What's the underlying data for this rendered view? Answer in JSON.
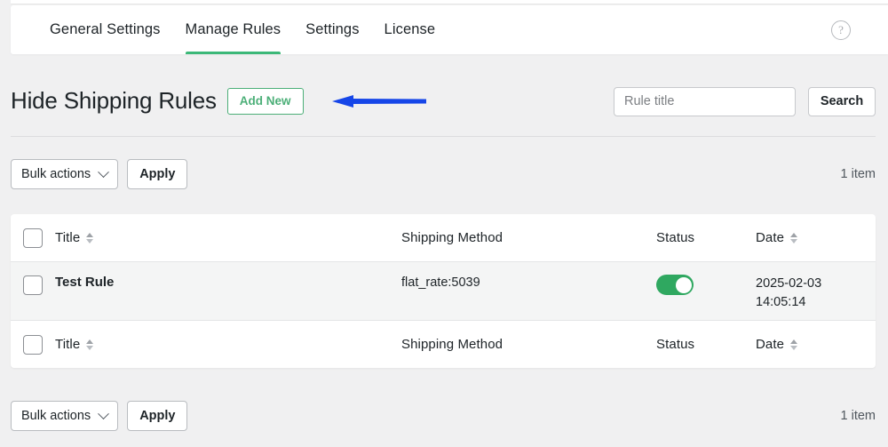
{
  "tabbar": {
    "tabs": [
      {
        "label": "General Settings",
        "active": false
      },
      {
        "label": "Manage Rules",
        "active": true
      },
      {
        "label": "Settings",
        "active": false
      },
      {
        "label": "License",
        "active": false
      }
    ],
    "help_icon_glyph": "?"
  },
  "header": {
    "title": "Hide Shipping Rules",
    "add_new_label": "Add New",
    "search_placeholder": "Rule title",
    "search_value": "",
    "search_button_label": "Search"
  },
  "annotation": {
    "type": "arrow-left",
    "color": "#1646e8"
  },
  "bulk_top": {
    "select_label": "Bulk actions",
    "apply_label": "Apply",
    "item_count": "1 item"
  },
  "bulk_bottom": {
    "select_label": "Bulk actions",
    "apply_label": "Apply",
    "item_count": "1 item"
  },
  "table": {
    "columns": {
      "title": "Title",
      "method": "Shipping Method",
      "status": "Status",
      "date": "Date"
    },
    "rows": [
      {
        "title": "Test Rule",
        "method": "flat_rate:5039",
        "status_enabled": true,
        "date_line1": "2025-02-03",
        "date_line2": "14:05:14"
      }
    ]
  },
  "colors": {
    "accent_green": "#3cb878",
    "toggle_green": "#2fa860",
    "add_new_green": "#4caf78",
    "page_bg": "#f0f0f1",
    "row_bg": "#f4f5f5",
    "annotation_blue": "#1646e8"
  }
}
